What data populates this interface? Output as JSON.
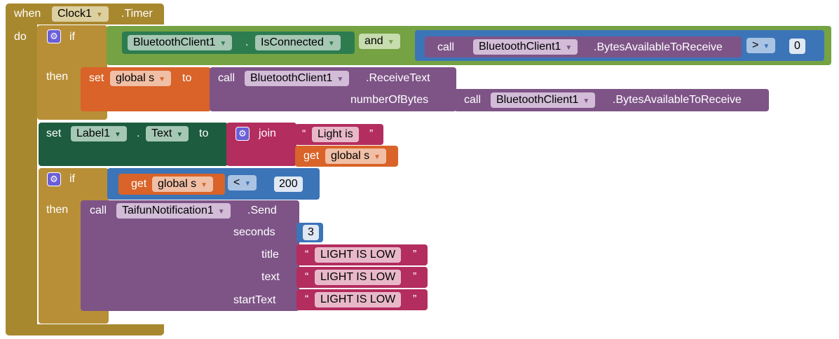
{
  "event": {
    "when_label": "when",
    "component": "Clock1",
    "event_name": ".Timer",
    "do_label": "do"
  },
  "if1": {
    "if_label": "if",
    "then_label": "then",
    "component_a": "BluetoothClient1",
    "dot": ".",
    "property_a": "IsConnected",
    "and_label": "and",
    "call_label": "call",
    "component_b": "BluetoothClient1",
    "method_b": ".BytesAvailableToReceive",
    "compare_op": ">",
    "compare_value": "0",
    "set_label": "set",
    "variable": "global s",
    "to_label": "to",
    "call2_label": "call",
    "component_c": "BluetoothClient1",
    "method_c": ".ReceiveText",
    "param_label": "numberOfBytes",
    "call3_label": "call",
    "component_d": "BluetoothClient1",
    "method_d": ".BytesAvailableToReceive"
  },
  "set_label_block": {
    "set_label": "set",
    "component": "Label1",
    "dot": ".",
    "property": "Text",
    "to_label": "to",
    "join_label": "join",
    "open_quote": "“",
    "text_value": "Light is",
    "close_quote": "”",
    "get_label": "get",
    "variable": "global s"
  },
  "if2": {
    "if_label": "if",
    "then_label": "then",
    "get_label": "get",
    "variable": "global s",
    "compare_op": "<",
    "compare_value": "200",
    "call_label": "call",
    "component": "TaifunNotification1",
    "method": ".Send",
    "params": {
      "seconds_label": "seconds",
      "seconds_value": "3",
      "title_label": "title",
      "title_value": "LIGHT IS LOW",
      "text_label": "text",
      "text_value": "LIGHT IS LOW",
      "starttext_label": "startText",
      "starttext_value": "LIGHT IS LOW"
    },
    "open_quote": "“",
    "close_quote": "”"
  },
  "colors": {
    "event": "#a8882f",
    "control": "#b88f37",
    "logic": "#75a243",
    "component_green": "#2d7c4f",
    "component_purple": "#7e5487",
    "component_dark": "#1d5c3e",
    "math": "#3c74b8",
    "variable": "#d96328",
    "text": "#b32d5e"
  }
}
